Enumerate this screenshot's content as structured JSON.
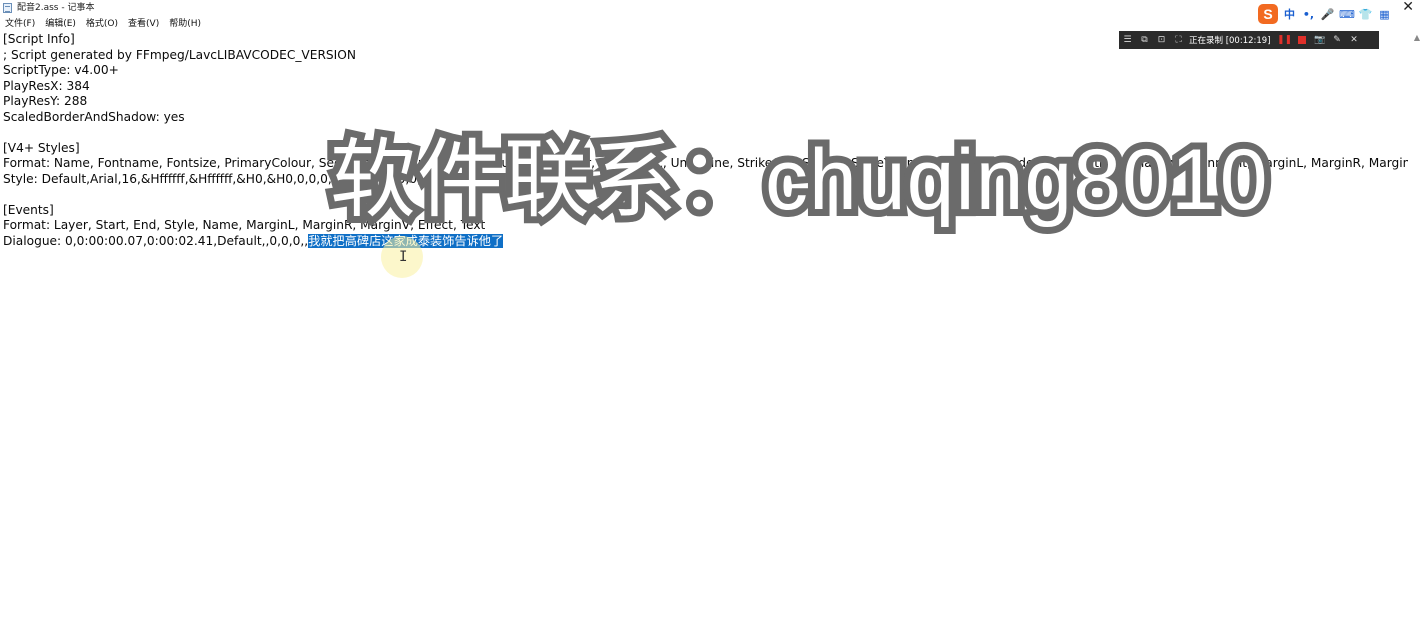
{
  "window": {
    "title": "配音2.ass - 记事本",
    "close_glyph": "✕"
  },
  "menu": {
    "items": [
      "文件(F)",
      "编辑(E)",
      "格式(O)",
      "查看(V)",
      "帮助(H)"
    ]
  },
  "editor": {
    "lines": [
      "[Script Info]",
      "; Script generated by FFmpeg/LavcLIBAVCODEC_VERSION",
      "ScriptType: v4.00+",
      "PlayResX: 384",
      "PlayResY: 288",
      "ScaledBorderAndShadow: yes",
      "",
      "[V4+ Styles]",
      "Format: Name, Fontname, Fontsize, PrimaryColour, SecondaryColour, OutlineColour, BackColour, Bold, Italic, Underline, StrikeOut, ScaleX, ScaleY, Spacing, Angle, BorderStyle, Outline, Shadow, Alignment, MarginL, MarginR, MarginV, Encoding",
      "Style: Default,Arial,16,&Hffffff,&Hffffff,&H0,&H0,0,0,0,0,100,100,0,0,1,1,0,2,10,10,10,0",
      "",
      "[Events]",
      "Format: Layer, Start, End, Style, Name, MarginL, MarginR, MarginV, Effect, Text"
    ],
    "dialogue_prefix": "Dialogue: 0,0:00:00.07,0:00:02.41,Default,,0,0,0,,",
    "dialogue_selected": "我就把高碑店这家成泰装饰告诉他了"
  },
  "ime": {
    "logo": "S",
    "buttons": [
      "中",
      "•,",
      "🎤",
      "⌨",
      "👕",
      "▦"
    ]
  },
  "recorder": {
    "icons": [
      "☰",
      "⧉",
      "⊡",
      "⛶"
    ],
    "status": "正在录制 [00:12:19]",
    "pause": "❚❚",
    "tools": [
      "📷",
      "✎",
      "✕"
    ]
  },
  "watermark": {
    "text": "软件联系：chuqing8010"
  },
  "colors": {
    "selection": "#0f6fc6",
    "ime_logo": "#f26a21",
    "recorder_bg": "#2b2b2b",
    "record_red": "#e0302a",
    "watermark_outline": "#6b6b6b"
  }
}
